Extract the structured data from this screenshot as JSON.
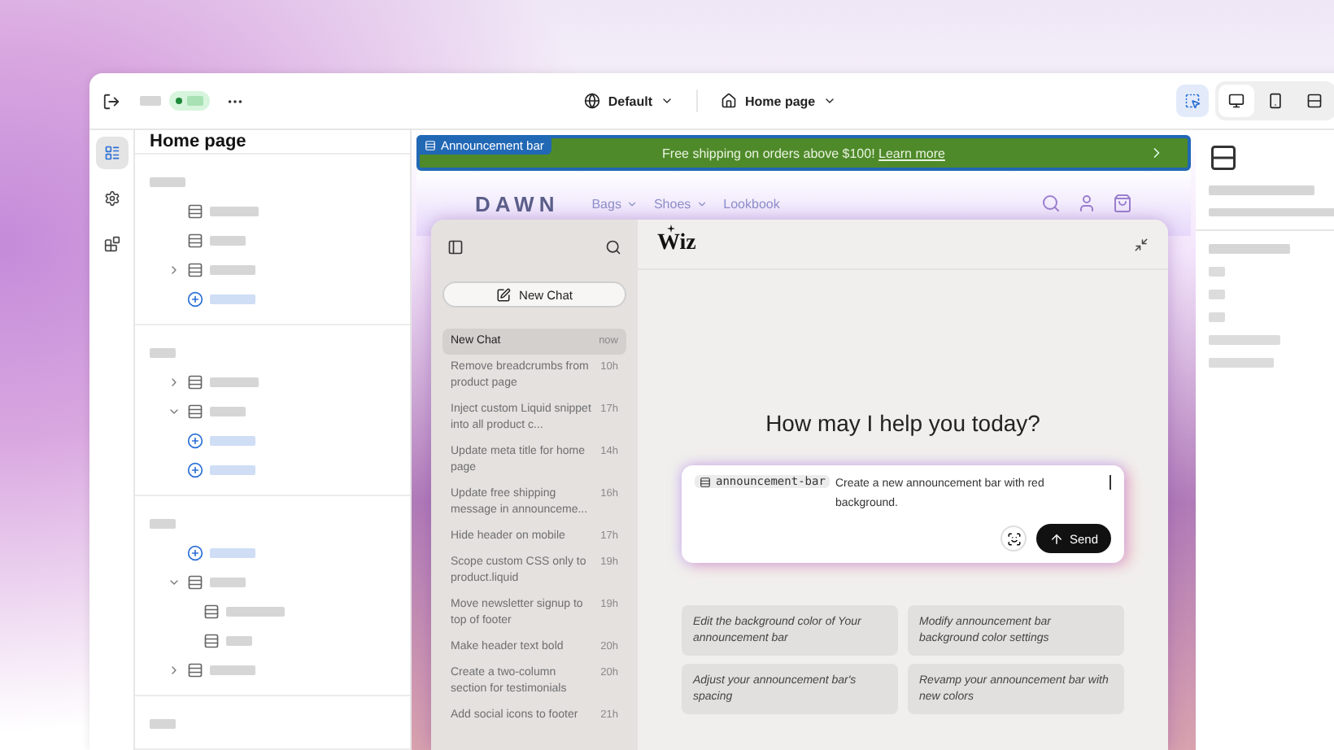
{
  "toolbar": {
    "theme": "Default",
    "page": "Home page",
    "inspector": {
      "selected": true
    },
    "devices": [
      {
        "kind": "desktop",
        "selected": true
      },
      {
        "kind": "mobile",
        "selected": false
      },
      {
        "kind": "fullwidth",
        "selected": false
      }
    ]
  },
  "rail": [
    {
      "kind": "sections",
      "selected": true
    },
    {
      "kind": "settings",
      "selected": false
    },
    {
      "kind": "apps",
      "selected": false
    }
  ],
  "tree": {
    "title": "Home page",
    "groups": [
      {
        "items": [
          {
            "kind": "section"
          },
          {
            "kind": "section"
          },
          {
            "kind": "section",
            "expanded": false
          },
          {
            "kind": "add"
          }
        ]
      },
      {
        "items": [
          {
            "kind": "section",
            "expanded": false
          },
          {
            "kind": "section",
            "expanded": true
          },
          {
            "kind": "add"
          },
          {
            "kind": "add"
          }
        ]
      },
      {
        "items": [
          {
            "kind": "add"
          },
          {
            "kind": "section",
            "expanded": true,
            "children": [
              {
                "kind": "section"
              },
              {
                "kind": "section"
              }
            ]
          },
          {
            "kind": "section",
            "expanded": false
          }
        ]
      }
    ]
  },
  "announcement": {
    "label": "Announcement bar",
    "text": "Free shipping on orders above $100!",
    "link": "Learn more"
  },
  "store": {
    "logo": "DAWN",
    "nav": [
      {
        "label": "Bags",
        "dropdown": true
      },
      {
        "label": "Shoes",
        "dropdown": true
      },
      {
        "label": "Lookbook",
        "dropdown": false
      }
    ]
  },
  "wiz": {
    "logo": "Wiz",
    "new_chat": "New Chat",
    "chats": [
      {
        "title": "New Chat",
        "time": "now",
        "selected": true
      },
      {
        "title": "Remove breadcrumbs from product page",
        "time": "10h",
        "selected": false
      },
      {
        "title": "Inject custom Liquid snippet into all product c...",
        "time": "17h",
        "selected": false
      },
      {
        "title": "Update meta title for home page",
        "time": "14h",
        "selected": false
      },
      {
        "title": "Update free shipping message in announceme...",
        "time": "16h",
        "selected": false
      },
      {
        "title": "Hide header on mobile",
        "time": "17h",
        "selected": false
      },
      {
        "title": "Scope custom CSS only to product.liquid",
        "time": "19h",
        "selected": false
      },
      {
        "title": "Move newsletter signup to top of footer",
        "time": "19h",
        "selected": false
      },
      {
        "title": "Make header text bold",
        "time": "20h",
        "selected": false
      },
      {
        "title": "Create a two-column section for testimonials",
        "time": "20h",
        "selected": false
      },
      {
        "title": "Add social icons to footer",
        "time": "21h",
        "selected": false
      }
    ],
    "greeting": "How may I help you today?",
    "prompt": {
      "chip": "announcement-bar",
      "value": "Create a new announcement bar with red background."
    },
    "send": "Send",
    "suggestions": [
      "Edit the background color of Your announcement bar",
      "Modify announcement bar background color settings",
      "Adjust your announcement bar's spacing",
      "Revamp your announcement bar with new colors"
    ]
  }
}
